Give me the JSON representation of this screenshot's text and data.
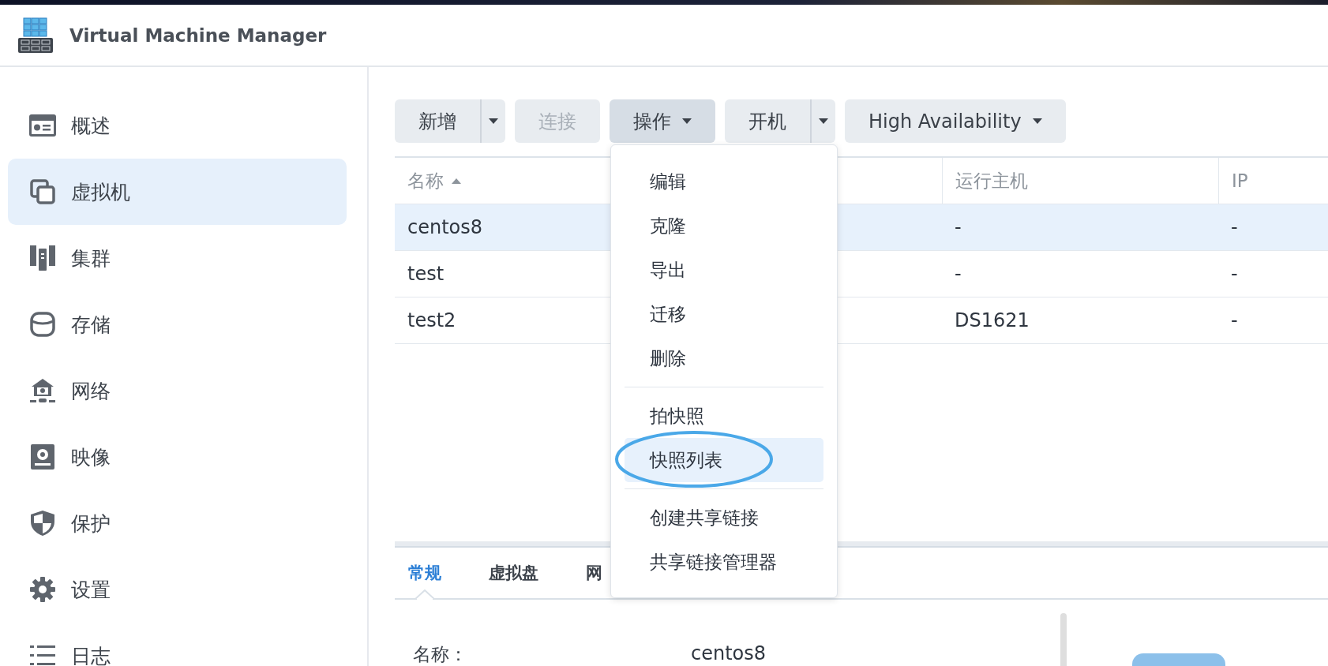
{
  "window": {
    "title": "Virtual Machine Manager"
  },
  "sidebar": {
    "items": [
      {
        "label": "概述",
        "selected": false
      },
      {
        "label": "虚拟机",
        "selected": true
      },
      {
        "label": "集群",
        "selected": false
      },
      {
        "label": "存储",
        "selected": false
      },
      {
        "label": "网络",
        "selected": false
      },
      {
        "label": "映像",
        "selected": false
      },
      {
        "label": "保护",
        "selected": false
      },
      {
        "label": "设置",
        "selected": false
      },
      {
        "label": "日志",
        "selected": false
      }
    ]
  },
  "toolbar": {
    "buttons": [
      {
        "label": "新增",
        "kind": "split",
        "disabled": false,
        "expanded": false
      },
      {
        "label": "连接",
        "kind": "plain",
        "disabled": true,
        "expanded": false
      },
      {
        "label": "操作",
        "kind": "menu",
        "disabled": false,
        "expanded": true
      },
      {
        "label": "开机",
        "kind": "split",
        "disabled": false,
        "expanded": false
      },
      {
        "label": "High Availability",
        "kind": "menu",
        "disabled": false,
        "expanded": false
      }
    ]
  },
  "action_menu": {
    "groups": [
      [
        {
          "label": "编辑",
          "selected": false,
          "circled": false
        },
        {
          "label": "克隆",
          "selected": false,
          "circled": false
        },
        {
          "label": "导出",
          "selected": false,
          "circled": false
        },
        {
          "label": "迁移",
          "selected": false,
          "circled": false
        },
        {
          "label": "删除",
          "selected": false,
          "circled": false
        }
      ],
      [
        {
          "label": "拍快照",
          "selected": false,
          "circled": false
        },
        {
          "label": "快照列表",
          "selected": true,
          "circled": true
        }
      ],
      [
        {
          "label": "创建共享链接",
          "selected": false,
          "circled": false
        },
        {
          "label": "共享链接管理器",
          "selected": false,
          "circled": false
        }
      ]
    ]
  },
  "table": {
    "columns": [
      {
        "label": "名称",
        "sorted_ascending": true
      },
      {
        "label": "运行主机",
        "sorted_ascending": false
      },
      {
        "label": "IP",
        "sorted_ascending": false
      }
    ],
    "rows": [
      {
        "selected": true,
        "cells": [
          "centos8",
          "-",
          "-"
        ]
      },
      {
        "selected": false,
        "cells": [
          "test",
          "-",
          "-"
        ]
      },
      {
        "selected": false,
        "cells": [
          "test2",
          "DS1621",
          "-"
        ]
      }
    ]
  },
  "details": {
    "tabs": [
      {
        "label": "常规",
        "selected": true
      },
      {
        "label": "虚拟盘",
        "selected": false
      },
      {
        "label": "网",
        "selected": false
      }
    ],
    "fields": [
      {
        "label": "名称：",
        "value": "centos8"
      }
    ]
  }
}
